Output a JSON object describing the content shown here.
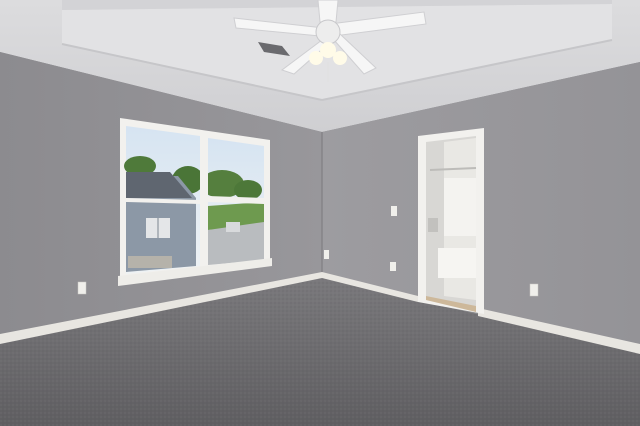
{
  "scene": {
    "description_colors": {
      "wall_left": "#8f8e92",
      "wall_right": "#9a999d",
      "ceiling": "#d9d9db",
      "carpet": "#6f6e70",
      "trim": "#e8e6e1",
      "sky": "#c9dcee",
      "foliage": "#4f7a3a"
    }
  }
}
